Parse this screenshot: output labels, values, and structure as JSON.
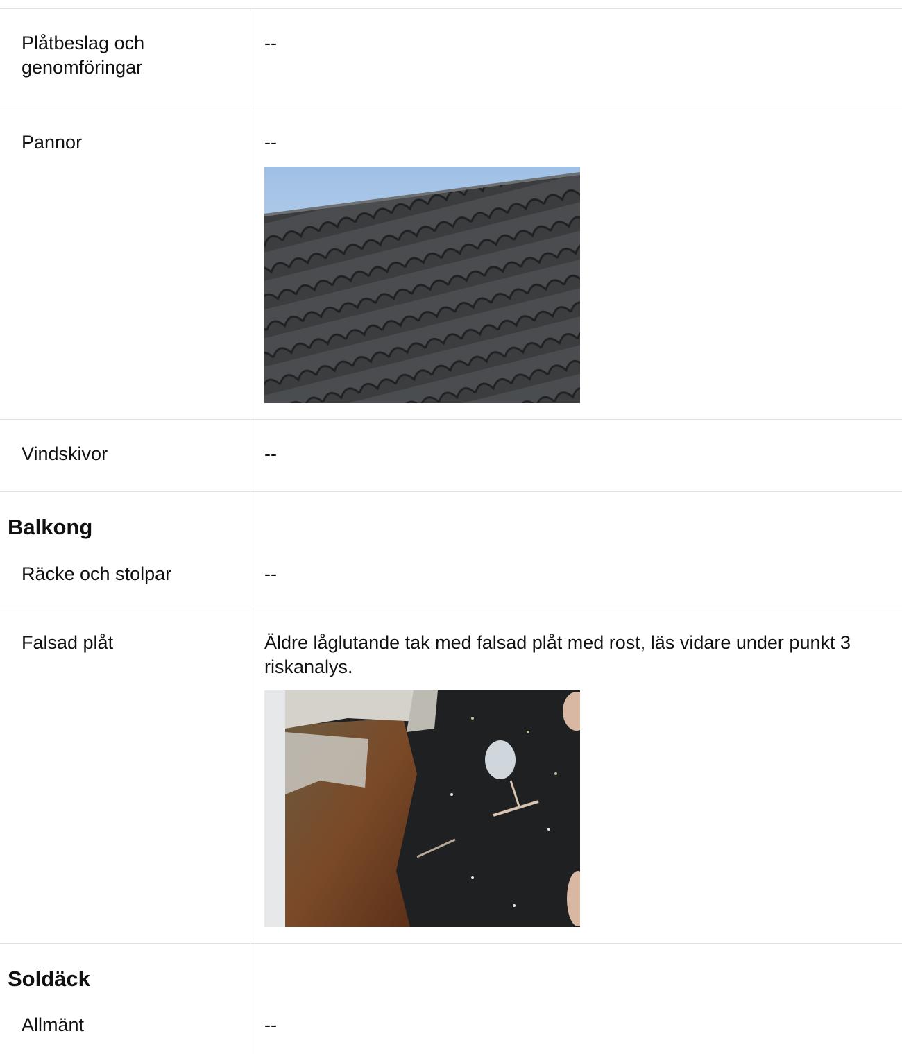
{
  "rows": [
    {
      "label": "Plåtbeslag och genomföringar",
      "value": "--"
    },
    {
      "label": "Pannor",
      "value": "--",
      "photo": "roof-tiles-photo"
    },
    {
      "label": "Vindskivor",
      "value": "--"
    }
  ],
  "sections": [
    {
      "heading": "Balkong",
      "rows": [
        {
          "label": "Räcke och stolpar",
          "value": "--"
        },
        {
          "label": "Falsad plåt",
          "value": "Äldre låglutande tak med falsad plåt med rost, läs vidare under punkt 3 riskanalys.",
          "photo": "rusted-sheet-metal-photo"
        }
      ]
    },
    {
      "heading": "Soldäck",
      "rows": [
        {
          "label": "Allmänt",
          "value": "--"
        }
      ]
    }
  ]
}
